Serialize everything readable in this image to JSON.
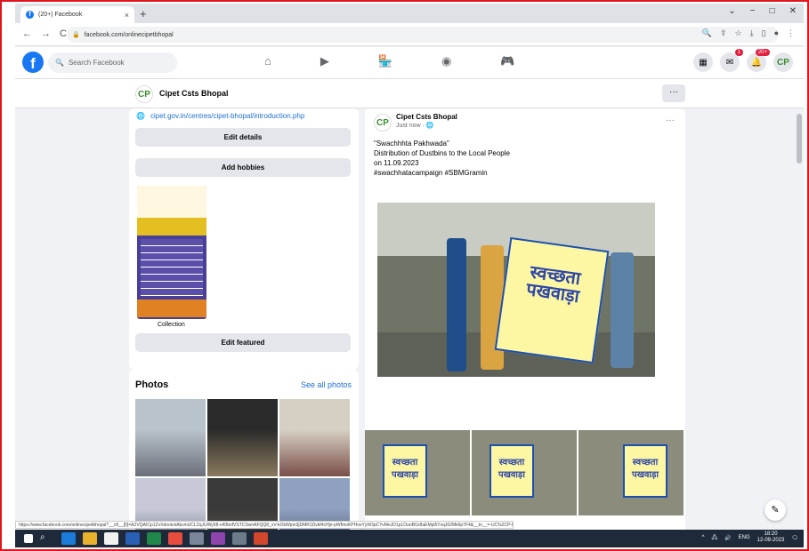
{
  "browser": {
    "tab_title": "(20+) Facebook",
    "tab_close": "×",
    "new_tab": "+",
    "window_controls": [
      "⌄",
      "−",
      "□",
      "✕"
    ],
    "nav": [
      "←",
      "→",
      "C"
    ],
    "url": "facebook.com/onlinecipetbhopal",
    "status_url": "https://www.facebook.com/onlinecipetbhopal?__cft__[0]=AZVQAICp1ZvXdootckAkcmUCLZqJUWy58-v40bnfVSTCSwnAFQQ8_xV-kOkWpm3jDMR1Dvkf4cHjn-pWfmoKPHosYyW3pCYvMeJD1p1OunBGr8aEMpi5YxqJ62Mk6p7F4&__tn__=-UC%2CP-R"
  },
  "fb": {
    "search_placeholder": "Search Facebook",
    "messenger_badge": "1",
    "notif_badge": "20+"
  },
  "page": {
    "name": "Cipet Csts Bhopal",
    "more": "···"
  },
  "left": {
    "website": "cipet.gov.in/centres/cipet-bhopal/introduction.php",
    "edit_details": "Edit details",
    "add_hobbies": "Add hobbies",
    "collection_label": "Collection",
    "edit_featured": "Edit featured"
  },
  "photos": {
    "heading": "Photos",
    "see_all": "See all photos"
  },
  "post": {
    "author": "Cipet Csts Bhopal",
    "time": "Just now · 🌐",
    "more": "···",
    "line1": "\"Swachhhta Pakhwada\"",
    "line2": "Distribution of Dustbins to the Local People",
    "line3": " on 11.09.2023",
    "line4": "#swachhatacampaign  #SBMGramin",
    "banner_text": "स्वच्छता पखवाड़ा",
    "thumb_banner": "स्वच्छता पखवाड़ा"
  },
  "taskbar": {
    "lang": "ENG",
    "time": "18:20",
    "date": "12-09-2023"
  },
  "colors": {
    "fb_blue": "#1877f2",
    "frame_red": "#e0151b",
    "link": "#1d6fd6"
  }
}
